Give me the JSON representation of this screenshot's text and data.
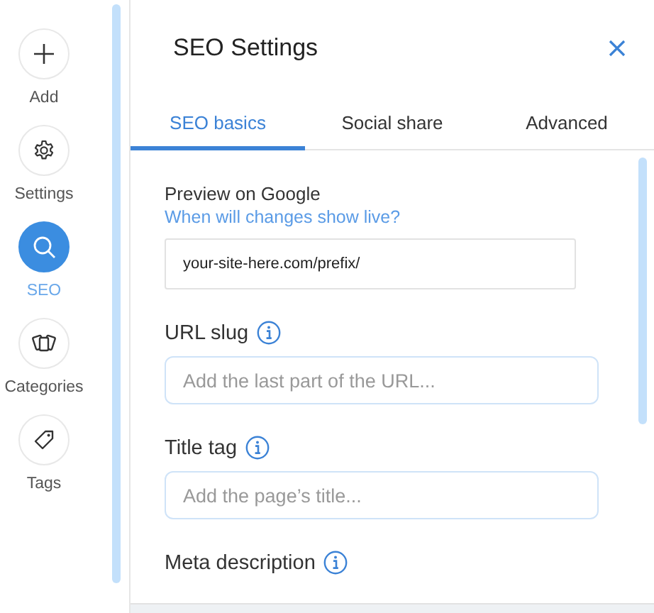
{
  "sidebar": {
    "items": [
      {
        "label": "Add",
        "selected": false
      },
      {
        "label": "Settings",
        "selected": false
      },
      {
        "label": "SEO",
        "selected": true
      },
      {
        "label": "Categories",
        "selected": false
      },
      {
        "label": "Tags",
        "selected": false
      }
    ]
  },
  "panel": {
    "title": "SEO Settings",
    "tabs": [
      {
        "label": "SEO basics",
        "selected": true
      },
      {
        "label": "Social share",
        "selected": false
      },
      {
        "label": "Advanced",
        "selected": false
      }
    ],
    "preview": {
      "label": "Preview on Google",
      "link": "When will changes show live?",
      "value": "your-site-here.com/prefix/"
    },
    "fields": [
      {
        "label": "URL slug",
        "placeholder": "Add the last part of the URL..."
      },
      {
        "label": "Title tag",
        "placeholder": "Add the page’s title..."
      },
      {
        "label": "Meta description"
      }
    ]
  }
}
